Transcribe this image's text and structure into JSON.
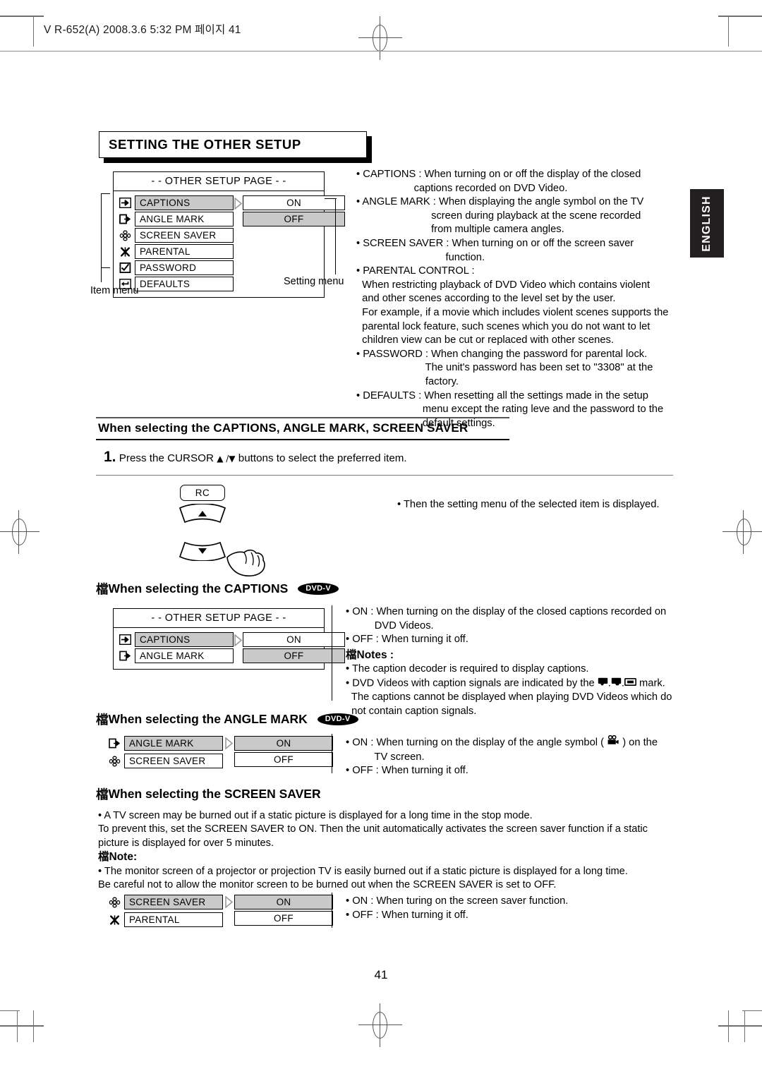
{
  "file_header": "V R-652(A)  2008.3.6  5:32 PM  페이지 41",
  "side_tab": {
    "label": "ENGLISH"
  },
  "section_title": "SETTING THE OTHER SETUP",
  "page_number": "41",
  "main_menu": {
    "header": "- - OTHER SETUP PAGE - -",
    "items": [
      {
        "label": "CAPTIONS",
        "selected": true,
        "icon": "arrow-right-filled-icon"
      },
      {
        "label": "ANGLE MARK",
        "selected": false,
        "icon": "arrow-exit-icon"
      },
      {
        "label": "SCREEN SAVER",
        "selected": false,
        "icon": "flower-icon"
      },
      {
        "label": "PARENTAL",
        "selected": false,
        "icon": "x-star-icon"
      },
      {
        "label": "PASSWORD",
        "selected": false,
        "icon": "checkbox-icon"
      },
      {
        "label": "DEFAULTS",
        "selected": false,
        "icon": "return-arrow-icon"
      }
    ],
    "settings": [
      {
        "label": "ON",
        "selected": false
      },
      {
        "label": "OFF",
        "selected": true
      }
    ],
    "item_menu_label": "Item menu",
    "setting_menu_label": "Setting menu"
  },
  "descriptions": [
    "• CAPTIONS : When turning on or off the display of the closed",
    "                    captions recorded on DVD Video.",
    "• ANGLE MARK : When displaying the angle symbol on the TV",
    "                          screen during playback at the scene recorded",
    "                          from multiple camera angles.",
    "• SCREEN SAVER : When turning on or off the screen saver",
    "                               function.",
    "• PARENTAL CONTROL :",
    "  When restricting playback of DVD Video which contains violent",
    "  and other scenes according to the level set by the user.",
    "  For example, if a movie which includes violent scenes supports the",
    "  parental lock feature, such scenes which you do not want to let",
    "  children view can be cut or replaced with other scenes.",
    "• PASSWORD : When changing the password for parental lock.",
    "                        The unit's password has been set to \"3308\" at the",
    "                        factory.",
    "• DEFAULTS : When resetting all the settings made in the setup",
    "                       menu except the rating leve and the password to the",
    "                       default settings."
  ],
  "selecting_heading": "When selecting the CAPTIONS, ANGLE MARK, SCREEN SAVER",
  "step1": {
    "number": "1.",
    "text_before": "Press the CURSOR",
    "cursor_glyphs": "▲ /▼",
    "text_after": "buttons to select the preferred item."
  },
  "remote": {
    "rc_label": "RC"
  },
  "step1_note": "• Then the setting menu of the selected item is displayed.",
  "captions_section": {
    "heading": "When selecting the CAPTIONS",
    "badge": "DVD-V",
    "menu": {
      "header": "- - OTHER SETUP PAGE - -",
      "items": [
        {
          "label": "CAPTIONS",
          "selected": true,
          "icon": "arrow-right-filled-icon"
        },
        {
          "label": "ANGLE MARK",
          "selected": false,
          "icon": "arrow-exit-icon"
        }
      ],
      "settings": [
        {
          "label": "ON",
          "selected": false
        },
        {
          "label": "OFF",
          "selected": true
        }
      ]
    },
    "lines": [
      "• ON : When turning on the display of the closed captions recorded on",
      "          DVD Videos.",
      "• OFF : When turning it off."
    ],
    "notes_head": "Notes :",
    "notes": [
      "• The caption decoder is required to display captions.",
      "• DVD Videos with caption signals are indicated by the",
      "  The captions cannot be displayed when playing DVD Videos which do",
      "  not contain caption signals."
    ],
    "notes_inline_tail": "mark."
  },
  "angle_section": {
    "heading": "When selecting the ANGLE MARK",
    "badge": "DVD-V",
    "menu": {
      "items": [
        {
          "label": "ANGLE MARK",
          "selected": true,
          "icon": "arrow-exit-icon"
        },
        {
          "label": "SCREEN SAVER",
          "selected": false,
          "icon": "flower-icon"
        }
      ],
      "settings": [
        {
          "label": "ON",
          "selected": true
        },
        {
          "label": "OFF",
          "selected": false
        }
      ]
    },
    "line_on_pre": "• ON : When turning on the display of the angle symbol (",
    "line_on_post": ") on the",
    "line_on_2": "          TV screen.",
    "line_off": "• OFF : When turning it off."
  },
  "screen_section": {
    "heading": "When selecting the SCREEN SAVER",
    "body": [
      "• A TV screen may be burned out if a static picture is displayed for a long time in the stop mode.",
      "  To prevent this, set the SCREEN SAVER to ON. Then the unit automatically activates the screen saver function if a static",
      "  picture is displayed for over 5 minutes."
    ],
    "note_head": "Note:",
    "note_body": [
      "• The monitor screen of a projector or projection TV is easily burned out if a static picture is displayed for a long time.",
      "  Be careful not to allow the monitor screen to be burned out when the SCREEN SAVER is set to OFF."
    ],
    "menu": {
      "items": [
        {
          "label": "SCREEN SAVER",
          "selected": true,
          "icon": "flower-icon"
        },
        {
          "label": "PARENTAL",
          "selected": false,
          "icon": "x-star-icon"
        }
      ],
      "settings": [
        {
          "label": "ON",
          "selected": true
        },
        {
          "label": "OFF",
          "selected": false
        }
      ]
    },
    "lines": [
      "• ON : When turing on the screen saver function.",
      "• OFF : When turning it off."
    ]
  },
  "bullet_glyph": "檔"
}
